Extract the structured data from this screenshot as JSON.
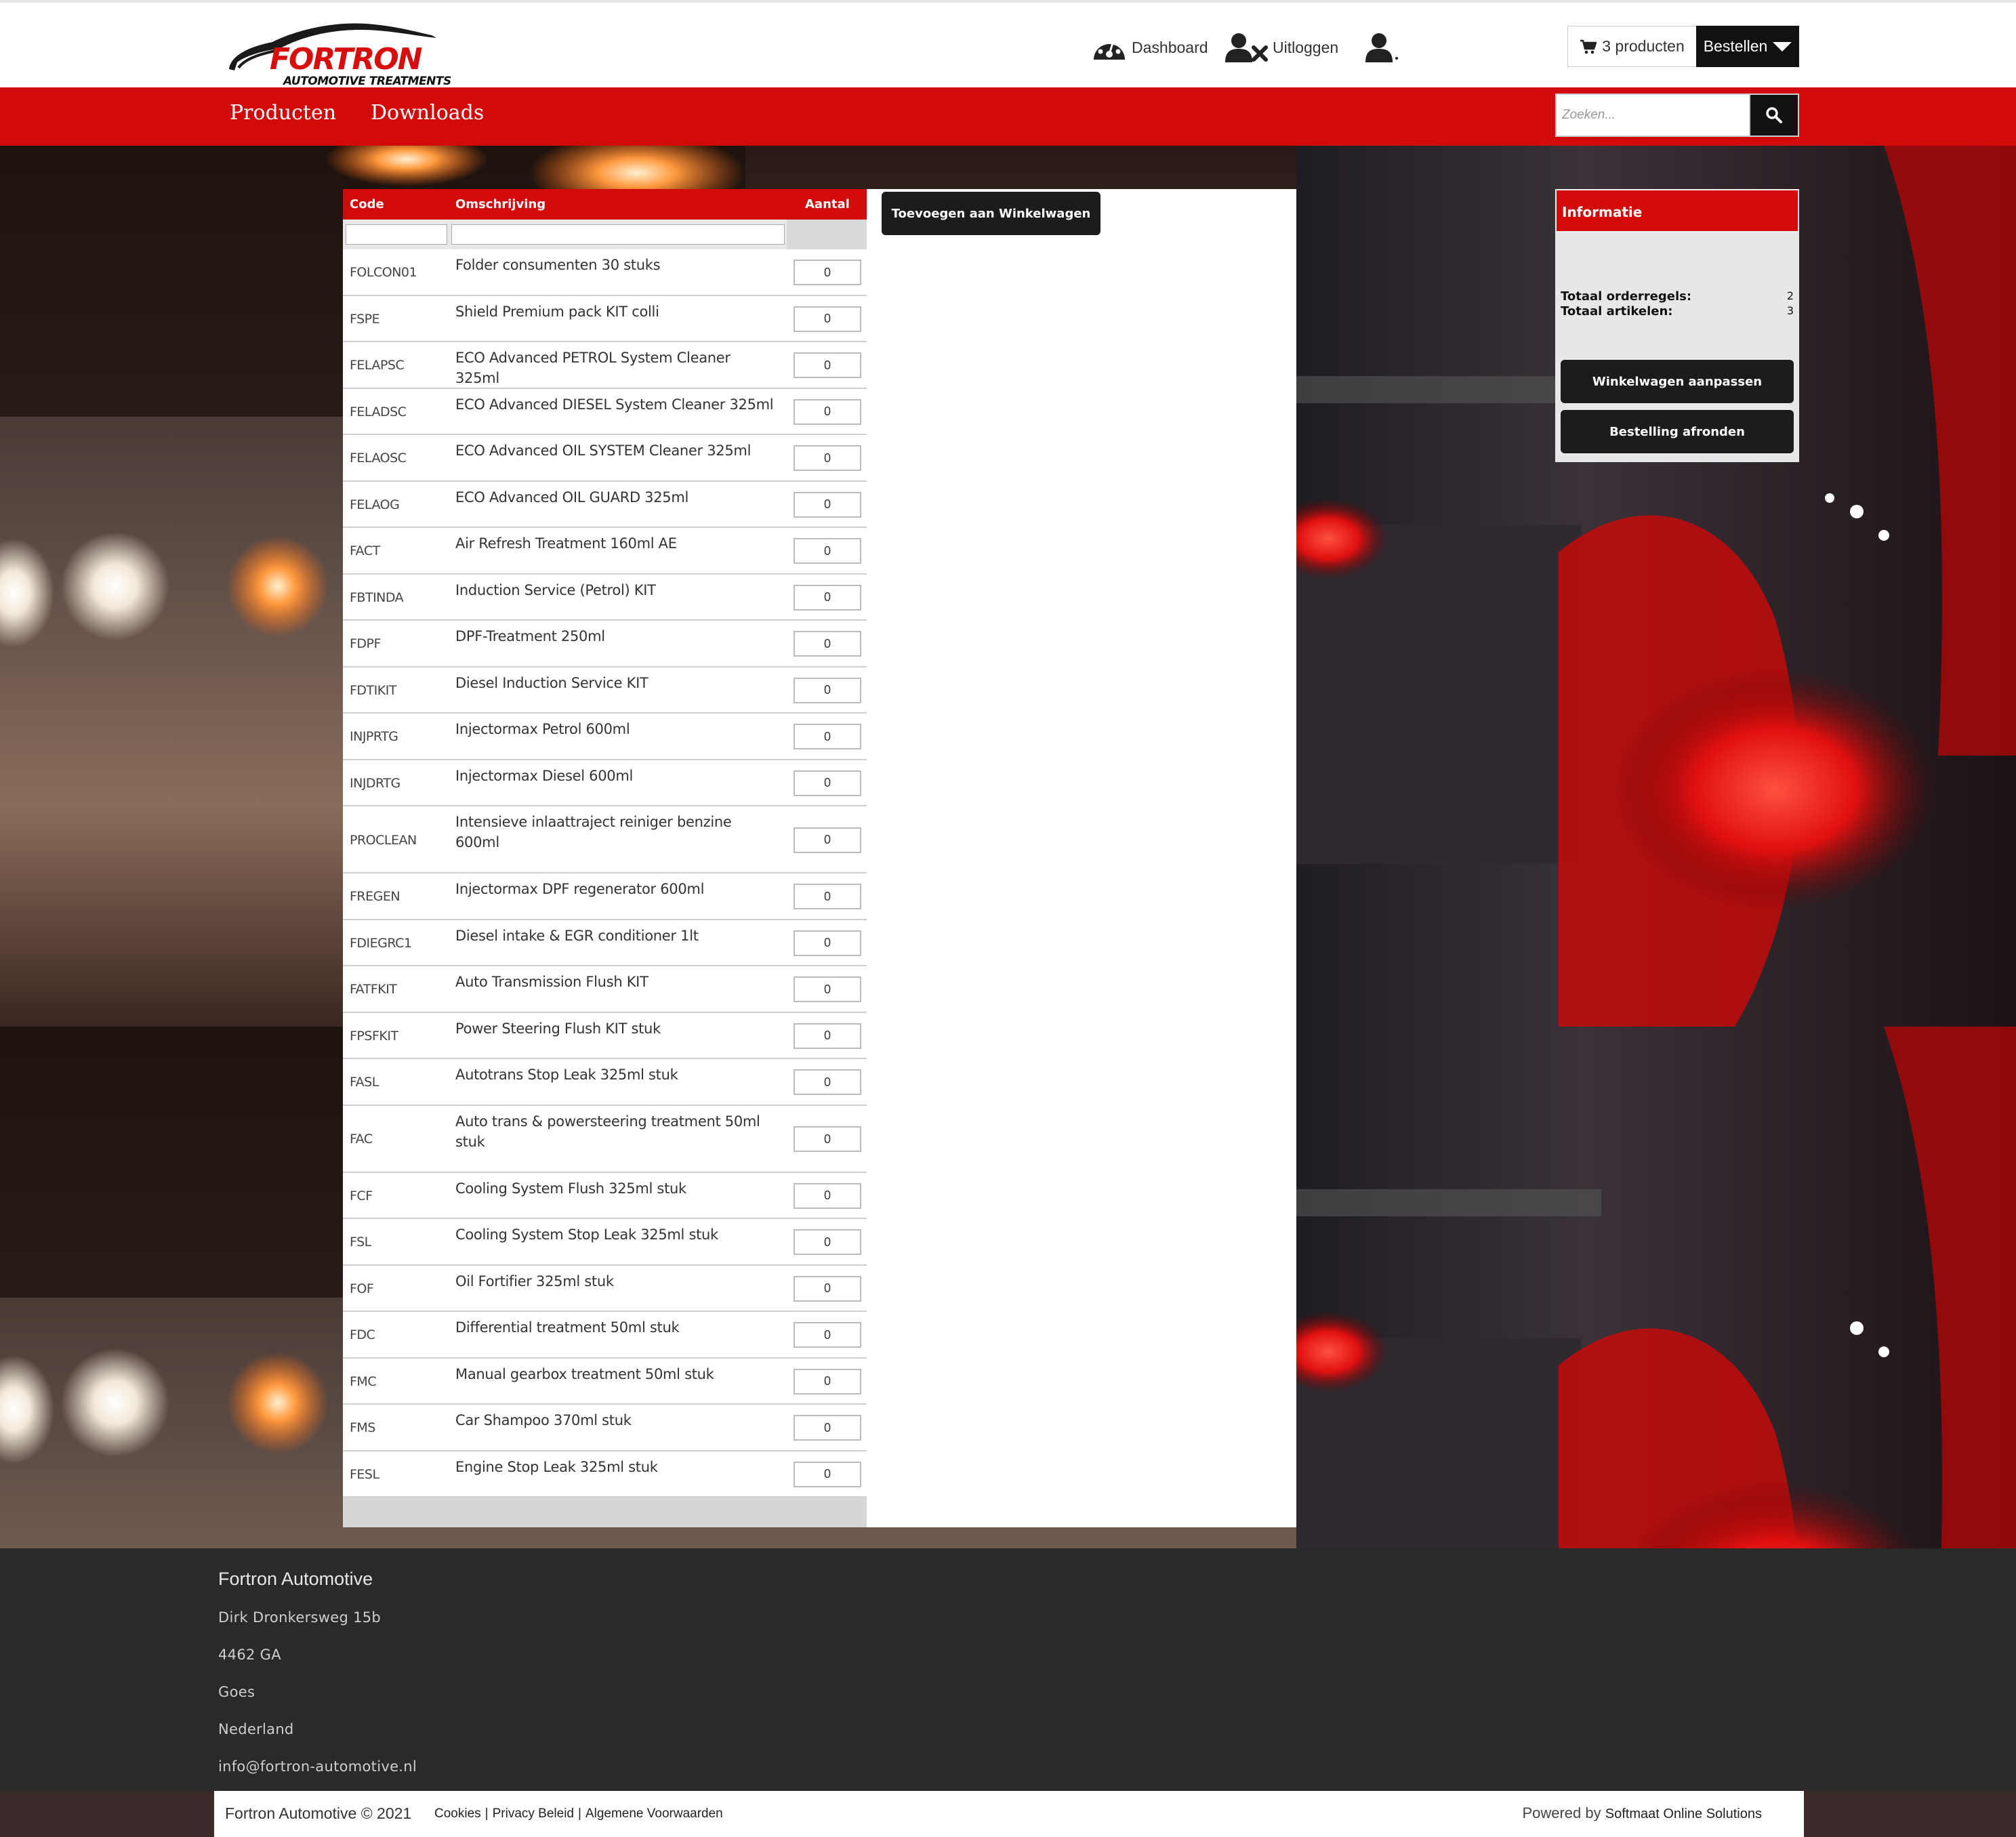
{
  "brand": {
    "logo_text": "FORTRON",
    "logo_sub": "AUTOMOTIVE TREATMENTS"
  },
  "header": {
    "dashboard_label": "Dashboard",
    "logout_label": "Uitloggen",
    "cart_label": "3 producten",
    "order_label": "Bestellen"
  },
  "menu": {
    "items": [
      {
        "label": "Producten"
      },
      {
        "label": "Downloads"
      }
    ],
    "search_placeholder": "Zoeken..."
  },
  "table": {
    "headers": {
      "code": "Code",
      "description": "Omschrijving",
      "quantity": "Aantal"
    },
    "rows": [
      {
        "code": "FOLCON01",
        "description": "Folder consumenten 30 stuks",
        "quantity": "0"
      },
      {
        "code": "FSPE",
        "description": "Shield Premium pack KIT colli",
        "quantity": "0"
      },
      {
        "code": "FELAPSC",
        "description": "ECO Advanced PETROL System Cleaner 325ml",
        "quantity": "0"
      },
      {
        "code": "FELADSC",
        "description": "ECO Advanced DIESEL System Cleaner 325ml",
        "quantity": "0"
      },
      {
        "code": "FELAOSC",
        "description": "ECO Advanced OIL SYSTEM Cleaner 325ml",
        "quantity": "0"
      },
      {
        "code": "FELAOG",
        "description": "ECO Advanced OIL GUARD 325ml",
        "quantity": "0"
      },
      {
        "code": "FACT",
        "description": "Air Refresh Treatment 160ml AE",
        "quantity": "0"
      },
      {
        "code": "FBTINDA",
        "description": "Induction Service (Petrol) KIT",
        "quantity": "0"
      },
      {
        "code": "FDPF",
        "description": "DPF-Treatment 250ml",
        "quantity": "0"
      },
      {
        "code": "FDTIKIT",
        "description": "Diesel Induction Service KIT",
        "quantity": "0"
      },
      {
        "code": "INJPRTG",
        "description": "Injectormax Petrol 600ml",
        "quantity": "0"
      },
      {
        "code": "INJDRTG",
        "description": "Injectormax Diesel 600ml",
        "quantity": "0"
      },
      {
        "code": "PROCLEAN",
        "description": "Intensieve inlaattraject reiniger benzine 600ml",
        "quantity": "0"
      },
      {
        "code": "FREGEN",
        "description": "Injectormax DPF regenerator 600ml",
        "quantity": "0"
      },
      {
        "code": "FDIEGRC1",
        "description": "Diesel intake & EGR conditioner 1lt",
        "quantity": "0"
      },
      {
        "code": "FATFKIT",
        "description": "Auto Transmission Flush KIT",
        "quantity": "0"
      },
      {
        "code": "FPSFKIT",
        "description": "Power Steering Flush KIT stuk",
        "quantity": "0"
      },
      {
        "code": "FASL",
        "description": "Autotrans Stop Leak 325ml stuk",
        "quantity": "0"
      },
      {
        "code": "FAC",
        "description": "Auto trans & powersteering treatment 50ml stuk",
        "quantity": "0"
      },
      {
        "code": "FCF",
        "description": "Cooling System Flush 325ml stuk",
        "quantity": "0"
      },
      {
        "code": "FSL",
        "description": "Cooling System Stop Leak 325ml stuk",
        "quantity": "0"
      },
      {
        "code": "FOF",
        "description": "Oil Fortifier 325ml stuk",
        "quantity": "0"
      },
      {
        "code": "FDC",
        "description": "Differential treatment 50ml stuk",
        "quantity": "0"
      },
      {
        "code": "FMC",
        "description": "Manual gearbox treatment 50ml stuk",
        "quantity": "0"
      },
      {
        "code": "FMS",
        "description": "Car Shampoo 370ml stuk",
        "quantity": "0"
      },
      {
        "code": "FESL",
        "description": "Engine Stop Leak 325ml stuk",
        "quantity": "0"
      }
    ]
  },
  "actions": {
    "add_to_cart": "Toevoegen aan Winkelwagen"
  },
  "info": {
    "title": "Informatie",
    "order_lines_label": "Totaal orderregels:",
    "order_lines_value": "2",
    "articles_label": "Totaal artikelen:",
    "articles_value": "3",
    "edit_cart": "Winkelwagen aanpassen",
    "finish_order": "Bestelling afronden"
  },
  "footer": {
    "company": "Fortron Automotive",
    "address": "Dirk Dronkersweg 15b",
    "postcode": "4462 GA",
    "city": "Goes",
    "country": "Nederland",
    "email": "info@fortron-automotive.nl",
    "copyright": "Fortron Automotive © 2021",
    "links": [
      "Cookies",
      "Privacy Beleid",
      "Algemene Voorwaarden"
    ],
    "powered_prefix": "Powered by",
    "powered_by": "Softmaat Online Solutions"
  },
  "colors": {
    "brand_red": "#d20a0a",
    "dark": "#1c1c1c",
    "footer_bg": "#2a2a2a"
  }
}
